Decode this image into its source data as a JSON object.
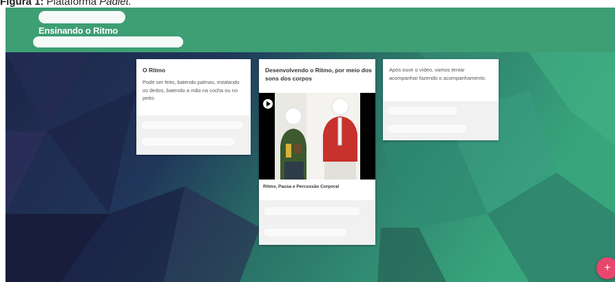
{
  "caption": {
    "label": "Figura 1:",
    "text": "Plataforma",
    "emphasis": "Padlet."
  },
  "board": {
    "title": "Ensinando o Ritmo"
  },
  "cards": [
    {
      "title": "O Ritmo",
      "body": "Pode ser feito, batendo palmas, estalando os dedos, batendo a mão na cocha ou no peito."
    },
    {
      "title": "Desenvolvendo o Ritmo, por meio dos sons dos corpos",
      "video_caption": "Ritmo, Pausa e Percussão Corporal"
    },
    {
      "body": "Após ouvir o vídeo, vamos tentar acompanhar fazendo o acompanhamento."
    }
  ],
  "icons": {
    "play": "play-icon",
    "add": "plus-icon"
  },
  "fab": {
    "label": "+"
  },
  "colors": {
    "header": "#3e9e74",
    "background_dark": "#1e2b4e",
    "background_green": "#3aa37a",
    "fab": "#e8466d"
  }
}
